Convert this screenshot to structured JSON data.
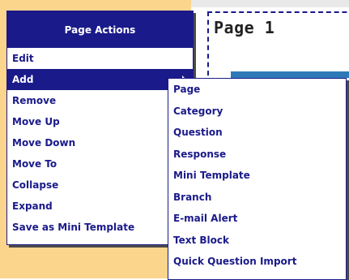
{
  "page": {
    "title": "Page 1"
  },
  "menu": {
    "header": "Page Actions",
    "items": [
      {
        "label": "Edit",
        "active": false
      },
      {
        "label": "Add",
        "active": true,
        "has_submenu": true
      },
      {
        "label": "Remove",
        "active": false
      },
      {
        "label": "Move Up",
        "active": false
      },
      {
        "label": "Move Down",
        "active": false
      },
      {
        "label": "Move To",
        "active": false
      },
      {
        "label": "Collapse",
        "active": false
      },
      {
        "label": "Expand",
        "active": false
      },
      {
        "label": "Save as Mini Template",
        "active": false
      }
    ]
  },
  "submenu": {
    "items": [
      {
        "label": "Page"
      },
      {
        "label": "Category"
      },
      {
        "label": "Question"
      },
      {
        "label": "Response"
      },
      {
        "label": "Mini Template"
      },
      {
        "label": "Branch"
      },
      {
        "label": "E-mail Alert"
      },
      {
        "label": "Text Block"
      },
      {
        "label": "Quick Question Import"
      }
    ]
  },
  "colors": {
    "menu_blue": "#1a1a8a",
    "left_band": "#fcd58d",
    "content_strip": "#2d79b8"
  },
  "icons": {
    "submenu_indicator": "chevron-right-icon"
  }
}
